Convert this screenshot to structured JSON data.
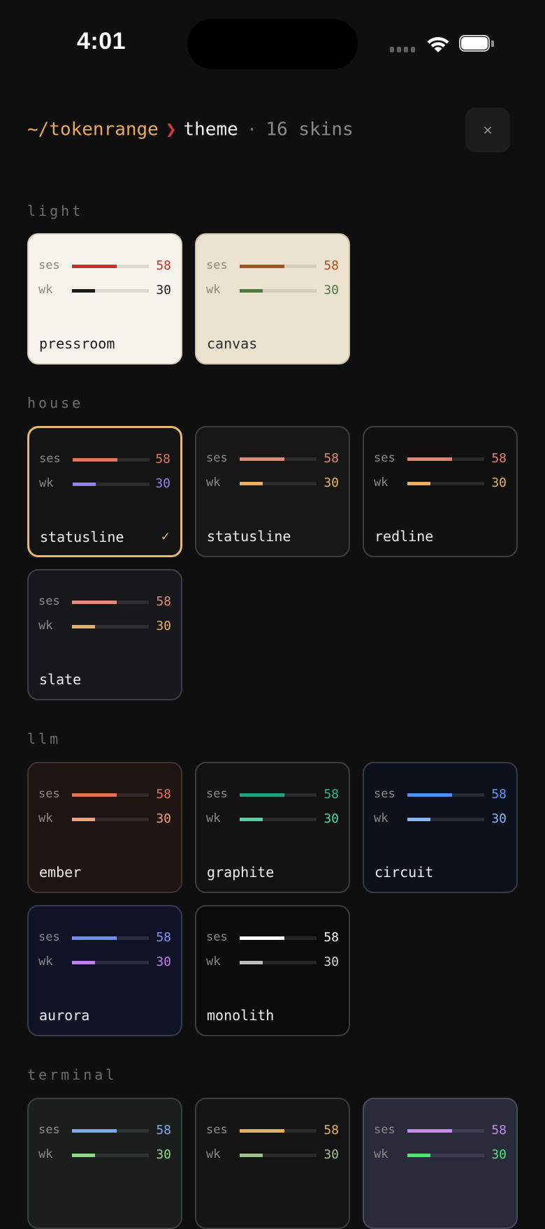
{
  "status_bar": {
    "time": "4:01"
  },
  "header": {
    "path": "~/tokenrange",
    "arrow": "❯",
    "title": "theme",
    "separator": "·",
    "count": "16 skins",
    "close_icon": "×"
  },
  "row_labels": {
    "session": "ses",
    "week": "wk"
  },
  "sections": [
    {
      "label": "light"
    },
    {
      "label": "house"
    },
    {
      "label": "llm"
    },
    {
      "label": "terminal"
    }
  ],
  "themes": [
    {
      "name": "pressroom",
      "section": "light",
      "selected": false,
      "ses_value": "58",
      "wk_value": "30",
      "ses_fill": 0.58,
      "wk_fill": 0.3,
      "bg": "#f6f3ec",
      "border": "#d8d2c6",
      "track": "#dedad2",
      "ses_color": "#c8302a",
      "wk_color": "#1a1a1a",
      "ses_text": "#c8302a",
      "wk_text": "#1a1a1a",
      "name_color": "#1a1a1a"
    },
    {
      "name": "canvas",
      "section": "light",
      "selected": false,
      "ses_value": "58",
      "wk_value": "30",
      "ses_fill": 0.58,
      "wk_fill": 0.3,
      "bg": "#ece2d0",
      "border": "#cfc3ad",
      "track": "#d8ccba",
      "ses_color": "#a9501f",
      "wk_color": "#4a7a40",
      "ses_text": "#a9501f",
      "wk_text": "#4a7a40",
      "name_color": "#2a2a2a"
    },
    {
      "name": "statusline",
      "section": "house",
      "selected": true,
      "ses_value": "58",
      "wk_value": "30",
      "ses_fill": 0.58,
      "wk_fill": 0.3,
      "bg": "#141414",
      "border": "#e8b86d",
      "track": "#2c2c2c",
      "ses_color": "#e0765a",
      "wk_color": "#8f84ee",
      "ses_text": "#e0765a",
      "wk_text": "#8f84ee",
      "name_color": "#f0f0f0"
    },
    {
      "name": "statusline",
      "section": "house",
      "selected": false,
      "ses_value": "58",
      "wk_value": "30",
      "ses_fill": 0.58,
      "wk_fill": 0.3,
      "bg": "#171717",
      "border": "#3d3d3d",
      "track": "#2c2c2c",
      "ses_color": "#e58a72",
      "wk_color": "#e6b05f",
      "ses_text": "#e58a72",
      "wk_text": "#e6b05f",
      "name_color": "#f0f0f0"
    },
    {
      "name": "redline",
      "section": "house",
      "selected": false,
      "ses_value": "58",
      "wk_value": "30",
      "ses_fill": 0.58,
      "wk_fill": 0.3,
      "bg": "#101010",
      "border": "#3d3d3d",
      "track": "#2a2a2a",
      "ses_color": "#e5806c",
      "wk_color": "#e6b05f",
      "ses_text": "#e5806c",
      "wk_text": "#e6b05f",
      "name_color": "#f0f0f0"
    },
    {
      "name": "slate",
      "section": "house",
      "selected": false,
      "ses_value": "58",
      "wk_value": "30",
      "ses_fill": 0.58,
      "wk_fill": 0.3,
      "bg": "#17181c",
      "border": "#3d3f45",
      "track": "#2c2e33",
      "ses_color": "#e58a78",
      "wk_color": "#e6b05f",
      "ses_text": "#e58a78",
      "wk_text": "#e6b05f",
      "name_color": "#f0f0f0"
    },
    {
      "name": "ember",
      "section": "llm",
      "selected": false,
      "ses_value": "58",
      "wk_value": "30",
      "ses_fill": 0.58,
      "wk_fill": 0.3,
      "bg": "#1e1412",
      "border": "#3f3330",
      "track": "#34282a",
      "ses_color": "#e0764f",
      "wk_color": "#f0a07a",
      "ses_text": "#e0764f",
      "wk_text": "#f0a07a",
      "name_color": "#f0f0f0"
    },
    {
      "name": "graphite",
      "section": "llm",
      "selected": false,
      "ses_value": "58",
      "wk_value": "30",
      "ses_fill": 0.58,
      "wk_fill": 0.3,
      "bg": "#121212",
      "border": "#3d3d3d",
      "track": "#2a2a2a",
      "ses_color": "#1fa07e",
      "wk_color": "#4dd6a0",
      "ses_text": "#2bb48a",
      "wk_text": "#4dd6a0",
      "name_color": "#f0f0f0"
    },
    {
      "name": "circuit",
      "section": "llm",
      "selected": false,
      "ses_value": "58",
      "wk_value": "30",
      "ses_fill": 0.58,
      "wk_fill": 0.3,
      "bg": "#0c111b",
      "border": "#333a48",
      "track": "#252b36",
      "ses_color": "#4f8ff0",
      "wk_color": "#8bb6f5",
      "ses_text": "#5b9af5",
      "wk_text": "#8bb6f5",
      "name_color": "#f0f0f0"
    },
    {
      "name": "aurora",
      "section": "llm",
      "selected": false,
      "ses_value": "58",
      "wk_value": "30",
      "ses_fill": 0.58,
      "wk_fill": 0.3,
      "bg": "#101226",
      "border": "#363a52",
      "track": "#2a2d40",
      "ses_color": "#6d8cf5",
      "wk_color": "#c37cf0",
      "ses_text": "#7a96f5",
      "wk_text": "#c37cf0",
      "name_color": "#f0f0f0"
    },
    {
      "name": "monolith",
      "section": "llm",
      "selected": false,
      "ses_value": "58",
      "wk_value": "30",
      "ses_fill": 0.58,
      "wk_fill": 0.3,
      "bg": "#0b0b0b",
      "border": "#3d3d3d",
      "track": "#262626",
      "ses_color": "#ffffff",
      "wk_color": "#bdbdbd",
      "ses_text": "#ffffff",
      "wk_text": "#d8d8d8",
      "name_color": "#f0f0f0"
    },
    {
      "name": "",
      "section": "terminal",
      "selected": false,
      "ses_value": "58",
      "wk_value": "30",
      "ses_fill": 0.58,
      "wk_fill": 0.3,
      "bg": "#1a1f1d",
      "border": "#3a413d",
      "track": "#2c3330",
      "ses_color": "#7fa8f5",
      "wk_color": "#8fdc8a",
      "ses_text": "#7fa8f5",
      "wk_text": "#8fdc8a",
      "name_color": "#f0f0f0"
    },
    {
      "name": "",
      "section": "terminal",
      "selected": false,
      "ses_value": "58",
      "wk_value": "30",
      "ses_fill": 0.58,
      "wk_fill": 0.3,
      "bg": "#141414",
      "border": "#3d3d3d",
      "track": "#2a2a2a",
      "ses_color": "#e6b05f",
      "wk_color": "#a4c08a",
      "ses_text": "#e6b05f",
      "wk_text": "#a4c08a",
      "name_color": "#f0f0f0"
    },
    {
      "name": "",
      "section": "terminal",
      "selected": false,
      "ses_value": "58",
      "wk_value": "30",
      "ses_fill": 0.58,
      "wk_fill": 0.3,
      "bg": "#2a2b3a",
      "border": "#4a4c5e",
      "track": "#3c3e50",
      "ses_color": "#c08cf0",
      "wk_color": "#4fe07a",
      "ses_text": "#c08cf0",
      "wk_text": "#4fe07a",
      "name_color": "#f0f0f0"
    }
  ]
}
